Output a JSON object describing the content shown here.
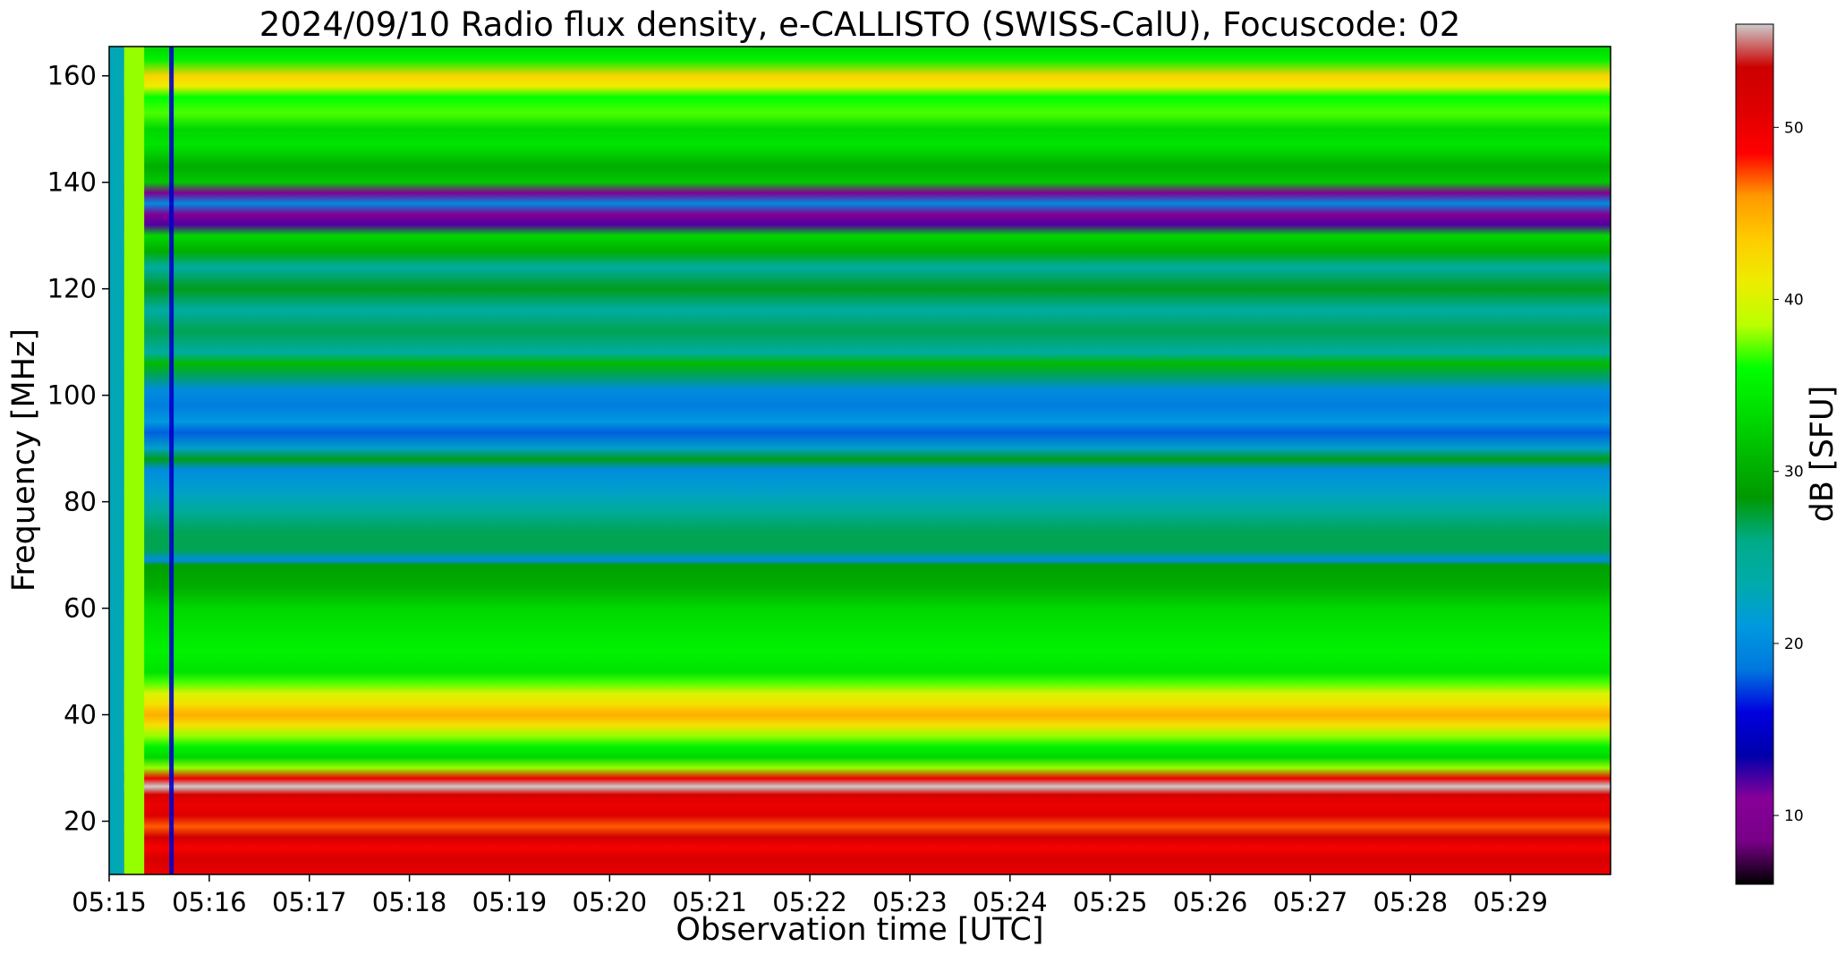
{
  "chart_data": {
    "type": "heatmap",
    "title": "2024/09/10  Radio flux density, e-CALLISTO (SWISS-CalU), Focuscode: 02",
    "xlabel": "Observation time [UTC]",
    "ylabel": "Frequency [MHz]",
    "x_tick_labels": [
      "05:15",
      "05:16",
      "05:17",
      "05:18",
      "05:19",
      "05:20",
      "05:21",
      "05:22",
      "05:23",
      "05:24",
      "05:25",
      "05:26",
      "05:27",
      "05:28",
      "05:29"
    ],
    "x_tick_values_min": [
      0,
      1,
      2,
      3,
      4,
      5,
      6,
      7,
      8,
      9,
      10,
      11,
      12,
      13,
      14
    ],
    "xlim_min": [
      0,
      15
    ],
    "y_tick_labels": [
      "20",
      "40",
      "60",
      "80",
      "100",
      "120",
      "140",
      "160"
    ],
    "y_tick_values": [
      20,
      40,
      60,
      80,
      100,
      120,
      140,
      160
    ],
    "ylim": [
      10,
      165.5
    ],
    "colorbar": {
      "label": "dB [SFU]",
      "tick_labels": [
        "10",
        "20",
        "30",
        "40",
        "50"
      ],
      "tick_values": [
        10,
        20,
        30,
        40,
        50
      ],
      "range": [
        6,
        56
      ],
      "colormap": "nipy_spectral"
    },
    "frequency_profile_db": [
      {
        "f": 10,
        "db": 50
      },
      {
        "f": 13,
        "db": 52
      },
      {
        "f": 15,
        "db": 49
      },
      {
        "f": 17,
        "db": 53
      },
      {
        "f": 19,
        "db": 47
      },
      {
        "f": 21,
        "db": 51
      },
      {
        "f": 23,
        "db": 50
      },
      {
        "f": 25,
        "db": 52
      },
      {
        "f": 26.5,
        "db": 56
      },
      {
        "f": 28,
        "db": 50
      },
      {
        "f": 30,
        "db": 38
      },
      {
        "f": 32,
        "db": 33
      },
      {
        "f": 34,
        "db": 35
      },
      {
        "f": 36,
        "db": 38
      },
      {
        "f": 38,
        "db": 42
      },
      {
        "f": 40,
        "db": 45
      },
      {
        "f": 42,
        "db": 42
      },
      {
        "f": 44,
        "db": 40
      },
      {
        "f": 46,
        "db": 37
      },
      {
        "f": 48,
        "db": 34
      },
      {
        "f": 52,
        "db": 35
      },
      {
        "f": 56,
        "db": 34
      },
      {
        "f": 60,
        "db": 33
      },
      {
        "f": 64,
        "db": 30
      },
      {
        "f": 68,
        "db": 29
      },
      {
        "f": 69,
        "db": 20
      },
      {
        "f": 71,
        "db": 27
      },
      {
        "f": 74,
        "db": 27
      },
      {
        "f": 78,
        "db": 25
      },
      {
        "f": 82,
        "db": 22
      },
      {
        "f": 86,
        "db": 20
      },
      {
        "f": 88,
        "db": 28
      },
      {
        "f": 90,
        "db": 22
      },
      {
        "f": 93,
        "db": 18
      },
      {
        "f": 95,
        "db": 21
      },
      {
        "f": 98,
        "db": 19
      },
      {
        "f": 101,
        "db": 20
      },
      {
        "f": 104,
        "db": 27
      },
      {
        "f": 106,
        "db": 31
      },
      {
        "f": 108,
        "db": 24
      },
      {
        "f": 112,
        "db": 27
      },
      {
        "f": 116,
        "db": 24
      },
      {
        "f": 120,
        "db": 28
      },
      {
        "f": 124,
        "db": 24
      },
      {
        "f": 127,
        "db": 30
      },
      {
        "f": 130,
        "db": 33
      },
      {
        "f": 132,
        "db": 12
      },
      {
        "f": 134,
        "db": 10
      },
      {
        "f": 136,
        "db": 20
      },
      {
        "f": 138,
        "db": 10
      },
      {
        "f": 140,
        "db": 32
      },
      {
        "f": 143,
        "db": 30
      },
      {
        "f": 147,
        "db": 34
      },
      {
        "f": 150,
        "db": 33
      },
      {
        "f": 153,
        "db": 37
      },
      {
        "f": 156,
        "db": 36
      },
      {
        "f": 158,
        "db": 41
      },
      {
        "f": 160,
        "db": 43
      },
      {
        "f": 163,
        "db": 35
      },
      {
        "f": 165.5,
        "db": 33
      }
    ],
    "grid": false,
    "legend": "colorbar-right"
  }
}
